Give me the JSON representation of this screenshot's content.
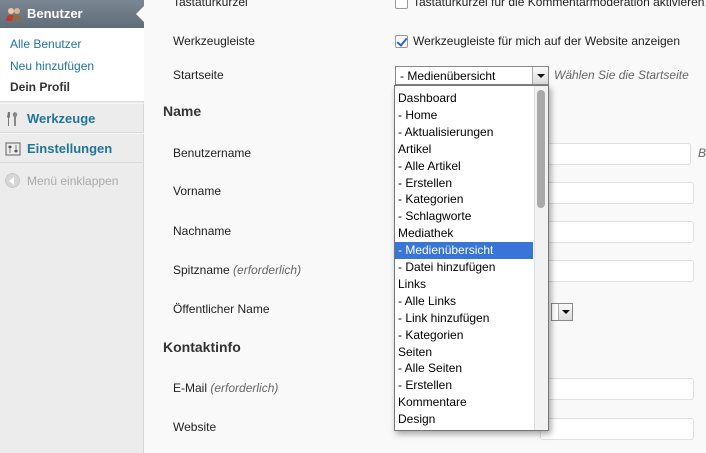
{
  "sidebar": {
    "header_label": "Benutzer",
    "submenu": [
      "Alle Benutzer",
      "Neu hinzufügen",
      "Dein Profil"
    ],
    "tools_label": "Werkzeuge",
    "settings_label": "Einstellungen",
    "collapse_label": "Menü einklappen"
  },
  "form": {
    "shortcuts_label": "Tastaturkürzel",
    "shortcuts_checkbox_text": "Tastaturkürzel für die Kommentarmoderation aktivieren.",
    "toolbar_label": "Werkzeugleiste",
    "toolbar_checkbox_text": "Werkzeugleiste für mich auf der Website anzeigen",
    "startpage_label": "Startseite",
    "startpage_value": "- Medienübersicht",
    "startpage_hint": "Wählen Sie die Startseite",
    "name_section": "Name",
    "username_label": "Benutzername",
    "username_hint": "B",
    "firstname_label": "Vorname",
    "lastname_label": "Nachname",
    "nickname_label": "Spitzname",
    "nickname_required": "(erforderlich)",
    "public_name_label": "Öffentlicher Name",
    "contact_section": "Kontaktinfo",
    "email_label": "E-Mail",
    "email_required": "(erforderlich)",
    "website_label": "Website"
  },
  "dropdown": {
    "options": [
      "Dashboard",
      "- Home",
      "- Aktualisierungen",
      "Artikel",
      "- Alle Artikel",
      "- Erstellen",
      "- Kategorien",
      "- Schlagworte",
      "Mediathek",
      "- Medienübersicht",
      "- Datei hinzufügen",
      "Links",
      "- Alle Links",
      "- Link hinzufügen",
      "- Kategorien",
      "Seiten",
      "- Alle Seiten",
      "- Erstellen",
      "Kommentare",
      "Design"
    ],
    "selected_index": 9
  }
}
